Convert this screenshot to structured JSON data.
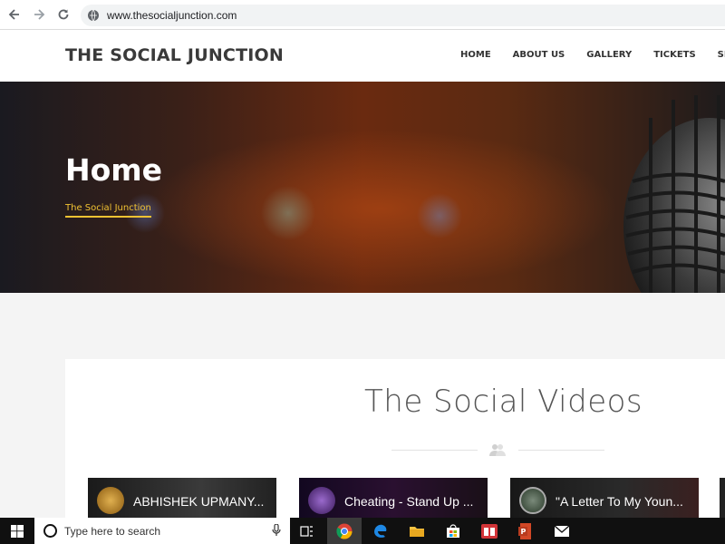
{
  "browser": {
    "url": "www.thesocialjunction.com",
    "icons": [
      "back-icon",
      "forward-icon",
      "reload-icon",
      "site-info-icon"
    ]
  },
  "header": {
    "logo": "THE SOCIAL JUNCTION",
    "nav": [
      "HOME",
      "ABOUT US",
      "GALLERY",
      "TICKETS",
      "SPONS"
    ]
  },
  "hero": {
    "title": "Home",
    "breadcrumb": "The Social Junction"
  },
  "section": {
    "title": "The Social Videos",
    "divider_icon": "people-icon"
  },
  "videos": [
    {
      "title": "ABHISHEK UPMANY...",
      "thumb_color": "#c8922a"
    },
    {
      "title": "Cheating - Stand Up ...",
      "thumb_color": "#6a3a9a"
    },
    {
      "title": "\"A Letter To My Youn...",
      "thumb_color": "#556a55"
    }
  ],
  "taskbar": {
    "search_placeholder": "Type here to search",
    "apps": [
      "windows-start-icon",
      "task-view-icon",
      "chrome-icon",
      "edge-icon",
      "file-explorer-icon",
      "store-icon",
      "red-app-icon",
      "powerpoint-icon",
      "mail-icon"
    ]
  },
  "colors": {
    "accent": "#f1c232",
    "logo": "#3a3a3a",
    "taskbar": "#101010"
  }
}
